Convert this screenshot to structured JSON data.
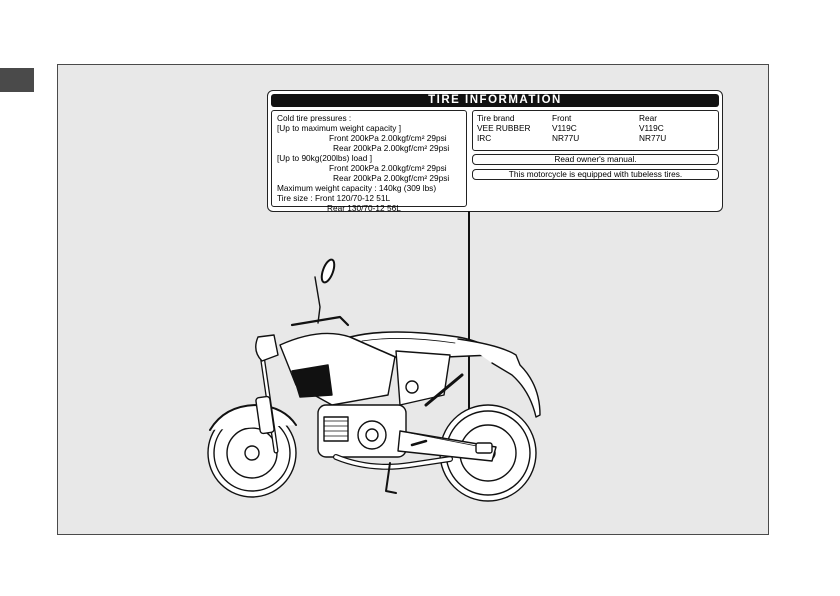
{
  "label": {
    "title": "TIRE  INFORMATION",
    "pressures": {
      "heading": "Cold  tire  pressures :",
      "max_condition": "[Up  to  maximum  weight  capacity ]",
      "max_front": "Front   200kPa  2.00kgf/cm²  29psi",
      "max_rear": "Rear   200kPa  2.00kgf/cm²  29psi",
      "load_condition": "[Up  to  90kg(200lbs)  load ]",
      "load_front": "Front   200kPa  2.00kgf/cm²  29psi",
      "load_rear": "Rear   200kPa  2.00kgf/cm²  29psi",
      "max_weight": "Maximum  weight  capacity : 140kg (309 lbs)",
      "size_front": "Tire  size  : Front 120/70-12  51L",
      "size_rear": "Rear  130/70-12  56L"
    },
    "brands": {
      "headers": [
        "Tire  brand",
        "Front",
        "Rear"
      ],
      "rows": [
        [
          "VEE RUBBER",
          "V119C",
          "V119C"
        ],
        [
          "IRC",
          "NR77U",
          "NR77U"
        ]
      ]
    },
    "manual_note": "Read  owner's  manual.",
    "tubeless_note": "This  motorcycle  is  equipped  with  tubeless  tires."
  }
}
